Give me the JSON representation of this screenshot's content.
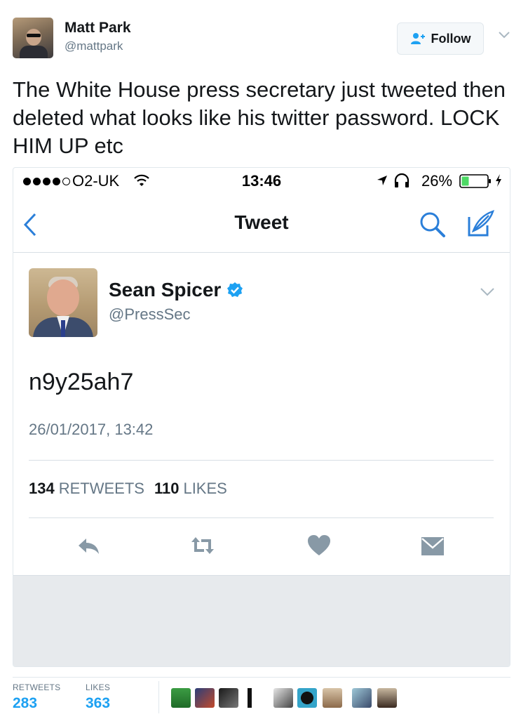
{
  "outer_tweet": {
    "name": "Matt Park",
    "handle": "@mattpark",
    "follow_label": "Follow",
    "text": "The White House press secretary just tweeted then deleted what looks like his twitter password. LOCK HIM UP etc"
  },
  "screenshot": {
    "status_bar": {
      "carrier": "O2-UK",
      "time": "13:46",
      "battery": "26%"
    },
    "nav": {
      "title": "Tweet"
    },
    "tweet": {
      "name": "Sean Spicer",
      "handle": "@PressSec",
      "text": "n9y25ah7",
      "timestamp": "26/01/2017, 13:42",
      "retweets": "134",
      "retweets_label": "RETWEETS",
      "likes": "110",
      "likes_label": "LIKES"
    }
  },
  "footer": {
    "retweets_label": "RETWEETS",
    "retweets_count": "283",
    "likes_label": "LIKES",
    "likes_count": "363"
  },
  "colors": {
    "accent": "#1da1f2",
    "ios_blue": "#2b7fd9",
    "muted": "#657786",
    "icon_gray": "#8899a6"
  }
}
